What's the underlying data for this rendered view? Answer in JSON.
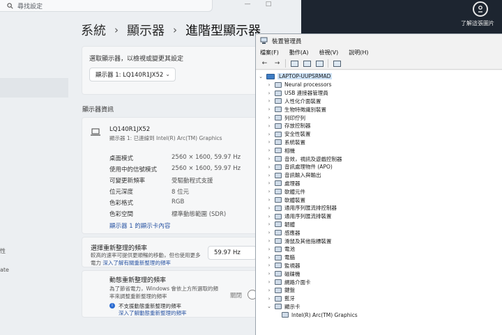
{
  "settings": {
    "search_placeholder": "尋找設定",
    "window_controls": [
      "—",
      "□"
    ],
    "sidebar_fragments": [
      "性",
      "ate"
    ],
    "breadcrumb": [
      "系統",
      "顯示器",
      "進階型顯示器"
    ],
    "select_prompt": "選取顯示器，以檢視或變更其設定",
    "selected_display": "顯示器 1: LQ140R1JX52",
    "section_title": "顯示器資訊",
    "monitor": {
      "name": "LQ140R1JX52",
      "subtitle": "顯示器 1: 已連線到 Intel(R) Arc(TM) Graphics"
    },
    "info": [
      {
        "label": "桌面模式",
        "value": "2560 × 1600, 59.97 Hz"
      },
      {
        "label": "使用中的信號模式",
        "value": "2560 × 1600, 59.97 Hz"
      },
      {
        "label": "可變更新頻率",
        "value": "受驅動程式支援"
      },
      {
        "label": "位元深度",
        "value": "8 位元"
      },
      {
        "label": "色彩格式",
        "value": "RGB"
      },
      {
        "label": "色彩空間",
        "value": "標準動態範圍 (SDR)"
      }
    ],
    "adapter_link": "顯示器 1 的顯示卡內容",
    "refresh": {
      "label": "選擇重新整理的頻率",
      "desc_line1": "較高的速率可提供更順暢的移動，但也使用更多",
      "desc_line2_prefix": "電力",
      "desc_line2_link": "深入了解有關重新整理的頻率",
      "value": "59.97 Hz"
    },
    "dynamic": {
      "title": "動態重新整理的頻率",
      "desc_line1": "為了節省電力，Windows 會依上方所選取的頻",
      "desc_line2": "率來調整重新整理的頻率",
      "note": "不支援動態重新整理的頻率",
      "note_link": "深入了解動態重新整理的頻率",
      "toggle_label": "關閉"
    }
  },
  "desktop": {
    "help_text": "了解這張圖片"
  },
  "devmgr": {
    "title": "裝置管理員",
    "menu": [
      "檔案(F)",
      "動作(A)",
      "檢視(V)",
      "說明(H)"
    ],
    "root": "LAPTOP-UUPSRMAD",
    "items": [
      "Neural processors",
      "USB 連接器管理員",
      "人性化介面裝置",
      "生物特徵識別裝置",
      "列印佇列",
      "存放控制器",
      "安全性裝置",
      "系統裝置",
      "相機",
      "音效，視訊及遊戲控制器",
      "音訊處理物件 (APO)",
      "音訊輸入與輸出",
      "處理器",
      "軟體元件",
      "軟體裝置",
      "通用序列匯流排控制器",
      "通用序列匯流排裝置",
      "韌體",
      "感應器",
      "滑鼠及其他指標裝置",
      "電池",
      "電腦",
      "監視器",
      "磁碟機",
      "網路介面卡",
      "鍵盤",
      "藍牙",
      "顯示卡"
    ],
    "child": "Intel(R) Arc(TM) Graphics"
  }
}
